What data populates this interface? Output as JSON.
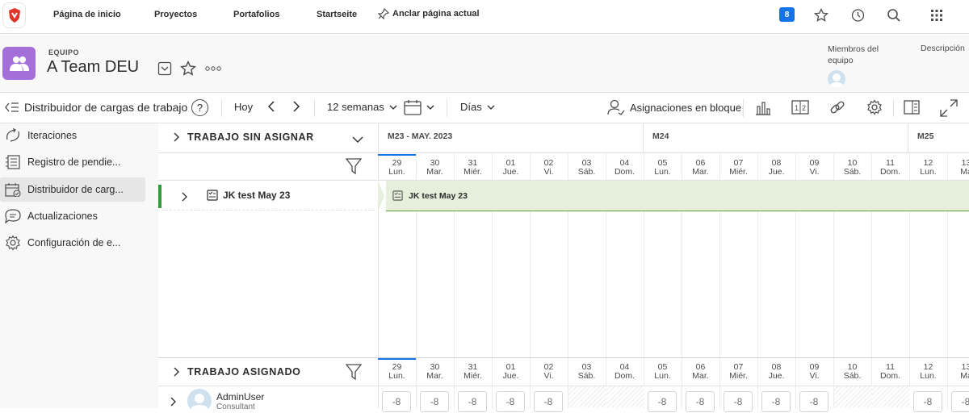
{
  "nav": {
    "links": [
      "Página de inicio",
      "Proyectos",
      "Portafolios",
      "Startseite"
    ],
    "pin_label": "Anclar página actual",
    "badge_count": "8"
  },
  "header": {
    "kind": "EQUIPO",
    "title": "A Team DEU",
    "members_label": "Miembros del equipo",
    "description_label": "Descripción"
  },
  "toolbar": {
    "page_title": "Distribuidor de cargas de trabajo",
    "help": "?",
    "today": "Hoy",
    "weeks": "12 semanas",
    "days": "Días",
    "bulk_assign": "Asignaciones en bloque"
  },
  "sidebar": {
    "items": [
      {
        "label": "Iteraciones",
        "icon": "iterations-icon"
      },
      {
        "label": "Registro de pendie...",
        "icon": "backlog-icon"
      },
      {
        "label": "Distribuidor de carg...",
        "icon": "workload-icon",
        "active": true
      },
      {
        "label": "Actualizaciones",
        "icon": "comment-icon"
      },
      {
        "label": "Configuración de e...",
        "icon": "gear-icon"
      }
    ]
  },
  "unassigned": {
    "header": "TRABAJO SIN ASIGNAR",
    "task_name": "JK test May 23",
    "bar_label": "JK test May 23"
  },
  "assigned": {
    "header": "TRABAJO ASIGNADO",
    "user_name": "AdminUser",
    "user_role": "Consultant",
    "hours": [
      "-8",
      "-8",
      "-8",
      "-8",
      "-8",
      "",
      "",
      "-8",
      "-8",
      "-8",
      "-8",
      "-8",
      "",
      "",
      "-8",
      "-8"
    ]
  },
  "timeline": {
    "months": [
      "M23 - MAY. 2023",
      "M24",
      "M25"
    ],
    "days": [
      {
        "num": "29",
        "dow": "Lun."
      },
      {
        "num": "30",
        "dow": "Mar."
      },
      {
        "num": "31",
        "dow": "Miér."
      },
      {
        "num": "01",
        "dow": "Jue."
      },
      {
        "num": "02",
        "dow": "Vi."
      },
      {
        "num": "03",
        "dow": "Sáb."
      },
      {
        "num": "04",
        "dow": "Dom."
      },
      {
        "num": "05",
        "dow": "Lun."
      },
      {
        "num": "06",
        "dow": "Mar."
      },
      {
        "num": "07",
        "dow": "Miér."
      },
      {
        "num": "08",
        "dow": "Jue."
      },
      {
        "num": "09",
        "dow": "Vi."
      },
      {
        "num": "10",
        "dow": "Sáb."
      },
      {
        "num": "11",
        "dow": "Dom."
      },
      {
        "num": "12",
        "dow": "Lun."
      },
      {
        "num": "13",
        "dow": "Ma"
      }
    ]
  },
  "colors": {
    "accent": "#1473e6",
    "team": "#a56fd9",
    "bar": "#e5efdb",
    "bar_edge": "#5c9a3a",
    "marker": "#2d9d3a"
  }
}
